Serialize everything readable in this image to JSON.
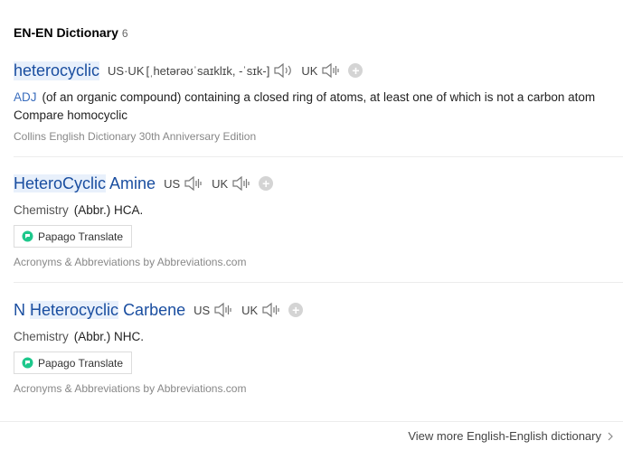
{
  "section": {
    "title": "EN-EN Dictionary",
    "count": "6"
  },
  "entries": [
    {
      "headword": "heterocyclic",
      "pron_label": "US·UK",
      "pron_text": "[ˌhetərəʊˈsaɪklɪk, -ˈsɪk-]",
      "uk_label": "UK",
      "pos": "ADJ",
      "definition": "(of an organic compound) containing a closed ring of atoms, at least one of which is not a carbon atom",
      "compare": "Compare homocyclic",
      "source": "Collins English Dictionary 30th Anniversary Edition"
    },
    {
      "headword_hl": "HeteroCyclic",
      "headword_rest": "Amine",
      "us_label": "US",
      "uk_label": "UK",
      "subject": "Chemistry",
      "abbr": "(Abbr.) HCA.",
      "translate": "Papago Translate",
      "source": "Acronyms & Abbreviations by Abbreviations.com"
    },
    {
      "headword_pre": "N",
      "headword_hl": "Heterocyclic",
      "headword_rest": "Carbene",
      "us_label": "US",
      "uk_label": "UK",
      "subject": "Chemistry",
      "abbr": "(Abbr.) NHC.",
      "translate": "Papago Translate",
      "source": "Acronyms & Abbreviations by Abbreviations.com"
    }
  ],
  "footer": {
    "more": "View more English-English dictionary"
  },
  "colors": {
    "headword": "#1a4ea0",
    "highlight": "#e8f0fb",
    "pos": "#3a6dbd"
  },
  "icons": [
    "speaker-icon",
    "add-icon",
    "papago-icon",
    "chevron-right-icon"
  ]
}
